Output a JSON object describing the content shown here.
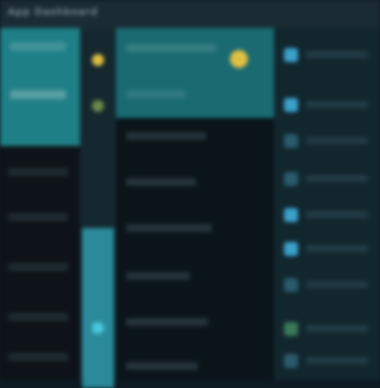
{
  "window": {
    "title": "App Dashboard"
  },
  "left_panel": {
    "items": [
      "",
      "",
      "",
      "",
      "",
      ""
    ]
  },
  "right_list": {
    "items": [
      "",
      "",
      "",
      "",
      "",
      "",
      "",
      "",
      ""
    ]
  },
  "colors": {
    "accent": "#1f7f86",
    "highlight": "#2a8a9a",
    "gold": "#e0c040",
    "blue": "#3aa0c8"
  }
}
